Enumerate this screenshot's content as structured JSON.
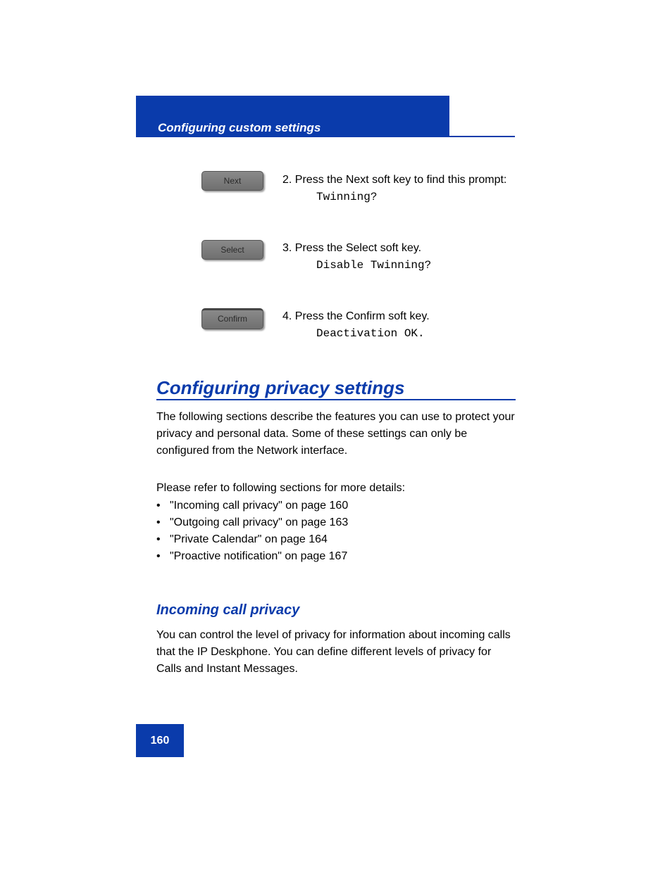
{
  "header": {
    "label": "Configuring custom settings"
  },
  "steps": [
    {
      "key_label": "Next",
      "line1": "2. Press the Next soft key to find this prompt:",
      "prompt": "Twinning?"
    },
    {
      "key_label": "Select",
      "line1": "3. Press the Select soft key.",
      "prompt": "Disable Twinning?"
    },
    {
      "key_label": "Confirm",
      "line1": "4. Press the Confirm soft key.",
      "prompt": "Deactivation OK."
    }
  ],
  "section": {
    "heading": "Configuring privacy settings",
    "para": "The following sections describe the features you can use to protect your privacy and personal data. Some of these settings can only be configured from the Network interface.",
    "list_intro": "Please refer to following sections for more details:",
    "list": [
      "\"Incoming call privacy\" on page 160",
      "\"Outgoing call privacy\" on page 163",
      "\"Private Calendar\" on page 164",
      "\"Proactive notification\" on page 167"
    ]
  },
  "subsection": {
    "heading": "Incoming call privacy",
    "para": "You can control the level of privacy for information about incoming calls that the IP Deskphone. You can define different levels of privacy for Calls and Instant Messages."
  },
  "page_number": "160"
}
